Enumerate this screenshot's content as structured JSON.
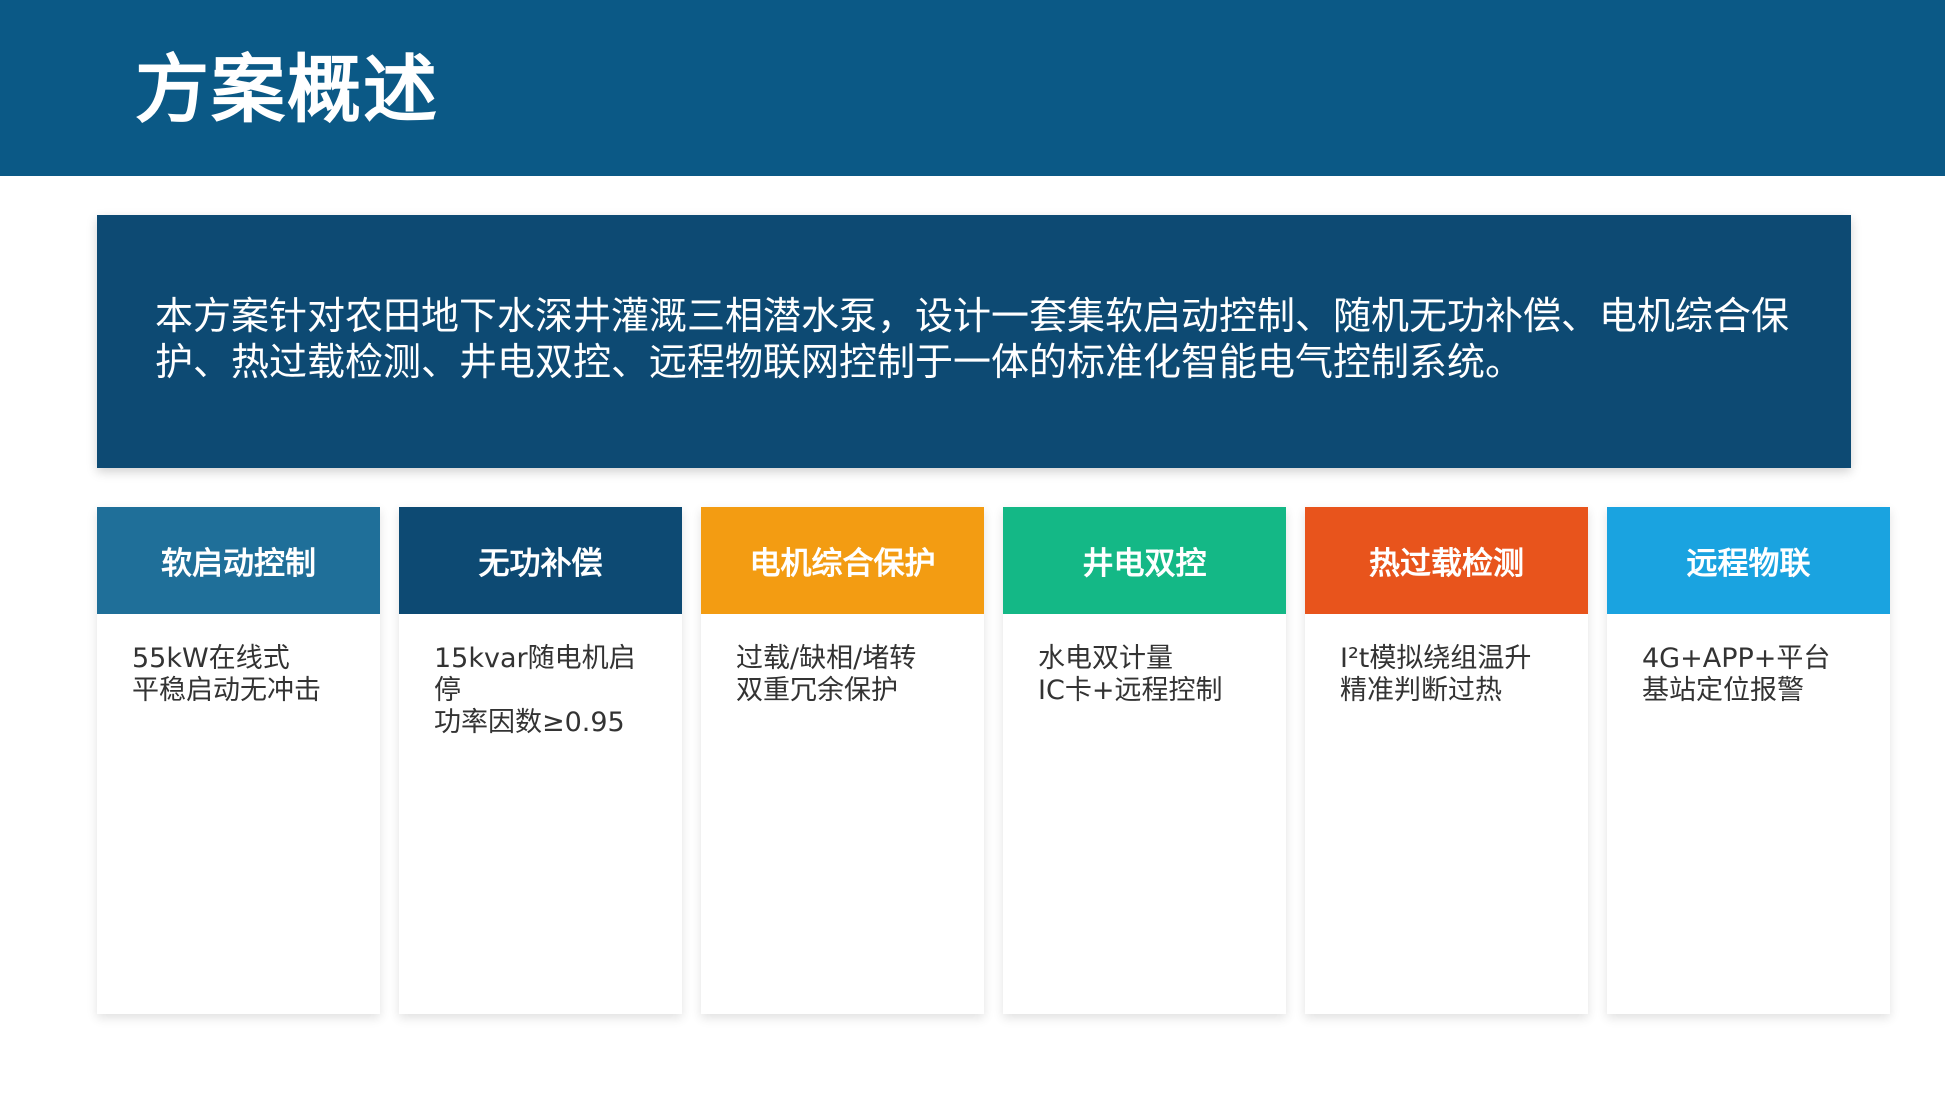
{
  "header": {
    "title": "方案概述",
    "background": "#0b5986"
  },
  "summary": {
    "text": "本方案针对农田地下水深井灌溉三相潜水泵，设计一套集软启动控制、随机无功补偿、电机综合保护、热过载检测、井电双控、远程物联网控制于一体的标准化智能电气控制系统。",
    "background": "#0d4a73"
  },
  "cards": [
    {
      "title": "软启动控制",
      "color": "#1f6f99",
      "lines": [
        "55kW在线式",
        "平稳启动无冲击"
      ]
    },
    {
      "title": "无功补偿",
      "color": "#0d4a73",
      "lines": [
        "15kvar随电机启停",
        "功率因数≥0.95"
      ]
    },
    {
      "title": "电机综合保护",
      "color": "#f39c12",
      "lines": [
        "过载/缺相/堵转",
        "双重冗余保护"
      ]
    },
    {
      "title": "井电双控",
      "color": "#14b886",
      "lines": [
        "水电双计量",
        "IC卡+远程控制"
      ]
    },
    {
      "title": "热过载检测",
      "color": "#e8541c",
      "lines": [
        "I²t模拟绕组温升",
        "精准判断过热"
      ]
    },
    {
      "title": "远程物联",
      "color": "#1aa3e0",
      "lines": [
        "4G+APP+平台",
        "基站定位报警"
      ]
    }
  ]
}
